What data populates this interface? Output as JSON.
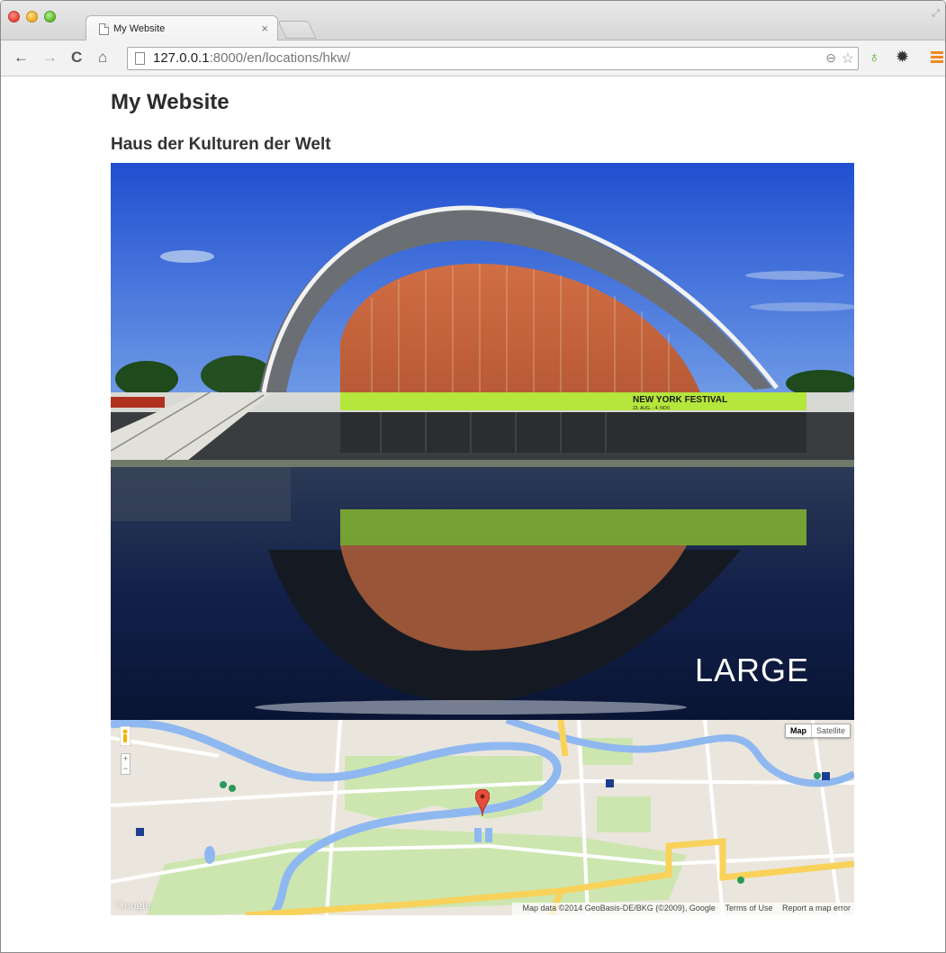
{
  "browser": {
    "tab_title": "My Website",
    "tab_close": "×",
    "url_host": "127.0.0.1",
    "url_rest": ":8000/en/locations/hkw/"
  },
  "page": {
    "site_title": "My Website",
    "location_title": "Haus der Kulturen der Welt",
    "image_badge": "LARGE",
    "banner_text": "NEW YORK FESTIVAL",
    "banner_dates": "23. AUG. - 4. NOV."
  },
  "map": {
    "type_map": "Map",
    "type_satellite": "Satellite",
    "zoom_in": "+",
    "zoom_out": "−",
    "attribution": "Map data ©2014 GeoBasis-DE/BKG (©2009), Google",
    "terms": "Terms of Use",
    "report": "Report a map error",
    "logo": "Google"
  },
  "icons": [
    "back-icon",
    "forward-icon",
    "reload-icon",
    "home-icon",
    "page-icon",
    "zoom-icon",
    "star-icon",
    "extension-icon",
    "gear-icon",
    "menu-icon",
    "pegman-icon",
    "map-marker-icon"
  ],
  "colors": {
    "sky": "#2a5bd6",
    "water": "#0c1a3c",
    "banner_green": "#b4e63c",
    "map_river": "#8fb8f0",
    "map_road": "#f8d25a",
    "map_park": "#cde6b0",
    "menu_orange": "#f18a1f"
  }
}
